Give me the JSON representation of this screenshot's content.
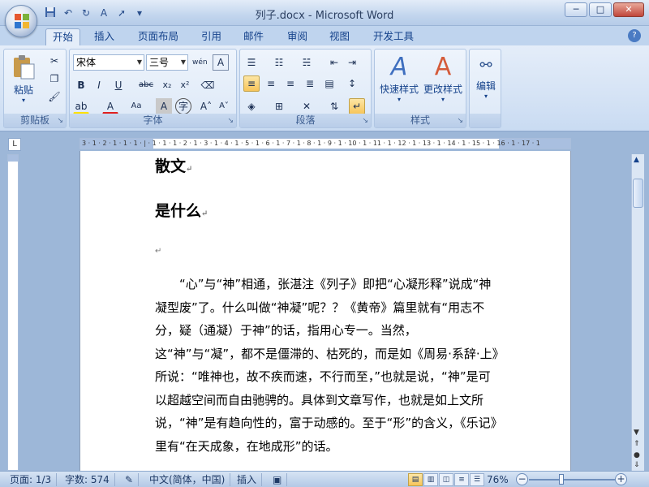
{
  "window": {
    "title": "列子.docx - Microsoft Word",
    "minimize": "─",
    "maximize": "□",
    "close": "✕"
  },
  "quick_access": [
    "save-icon",
    "undo-icon",
    "redo-icon",
    "format-painter-icon",
    "pointer-icon",
    "customize-icon"
  ],
  "tabs": [
    {
      "label": "开始",
      "active": true
    },
    {
      "label": "插入"
    },
    {
      "label": "页面布局"
    },
    {
      "label": "引用"
    },
    {
      "label": "邮件"
    },
    {
      "label": "审阅"
    },
    {
      "label": "视图"
    },
    {
      "label": "开发工具"
    }
  ],
  "help": "?",
  "ribbon": {
    "clipboard": {
      "label": "剪贴板",
      "paste": "粘贴"
    },
    "font": {
      "label": "字体",
      "font_name": "宋体",
      "font_size": "三号"
    },
    "paragraph": {
      "label": "段落"
    },
    "styles": {
      "label": "样式",
      "quick_styles": "快速样式",
      "change_styles": "更改样式"
    },
    "editing": {
      "label": "编辑",
      "button": "编辑"
    }
  },
  "ruler": {
    "corner": "L",
    "ticks": "3 · 1 · 2 · 1 · 1 · 1 · | · 1 · 1 · 1 · 2 · 1 · 3 · 1 · 4 · 1 · 5 · 1 · 6 · 1 · 7 · 1 · 8 · 1 · 9 · 1 · 10 · 1 · 11 · 1 · 12 · 1 · 13 · 1 · 14 · 1 · 15 · 1 · 16 · 1 · 17 · 1"
  },
  "document": {
    "heading1": "散文",
    "heading2": "是什么",
    "empty_mark": "↵",
    "paragraph": "“心”与“神”相通，张湛注《列子》即把“心凝形释”说成“神凝型废”了。什么叫做“神凝”呢？？《黄帝》篇里就有“用志不分，疑（通凝）于神”的话，指用心专一。当然，这“神”与“凝”，都不是僵滞的、枯死的，而是如《周易·系辞·上》所说：“唯神也，故不疾而速，不行而至，”也就是说，“神”是可以超越空间而自由驰骋的。具体到文章写作，也就是如上文所说，“神”是有趋向性的，富于动感的。至于“形”的含义，《乐记》里有“在天成象，在地成形”的话。"
  },
  "status": {
    "page": "页面: 1/3",
    "words": "字数: 574",
    "language": "中文(简体，中国)",
    "mode": "插入",
    "zoom": "76%",
    "zoom_minus": "−",
    "zoom_plus": "+",
    "zoom_value": 0.76
  },
  "colors": {
    "accent": "#15428b",
    "ribbon_bg": "#d5e3f5",
    "page": "#ffffff",
    "highlight": "#f7c55a"
  }
}
